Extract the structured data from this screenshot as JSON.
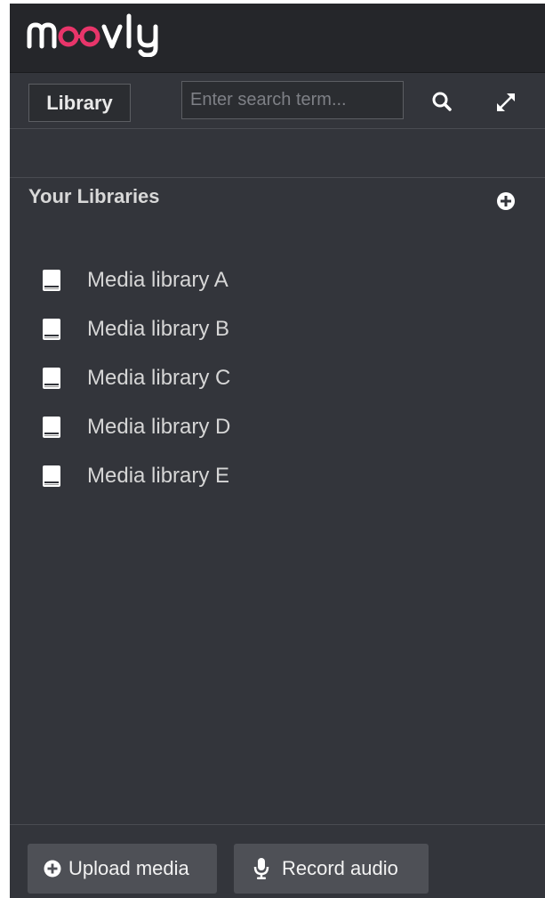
{
  "brand": {
    "logo_text": "moovly",
    "accent_color": "#e8356a"
  },
  "toolbar": {
    "library_label": "Library",
    "search_placeholder": "Enter search term...",
    "search_value": "",
    "search_icon": "search-icon",
    "expand_icon": "expand-icon"
  },
  "libraries": {
    "title": "Your Libraries",
    "add_icon": "plus-circle-icon",
    "items": [
      {
        "label": "Media library A",
        "icon": "book-icon"
      },
      {
        "label": "Media library B",
        "icon": "book-icon"
      },
      {
        "label": "Media library C",
        "icon": "book-icon"
      },
      {
        "label": "Media library D",
        "icon": "book-icon"
      },
      {
        "label": "Media library E",
        "icon": "book-icon"
      }
    ]
  },
  "footer": {
    "upload_label": "Upload media",
    "upload_icon": "plus-circle-icon",
    "record_label": "Record audio",
    "record_icon": "microphone-icon"
  },
  "colors": {
    "header_bg": "#25262a",
    "panel_bg": "#33353b",
    "button_bg": "#4e5056",
    "text": "#d6d6d6"
  }
}
